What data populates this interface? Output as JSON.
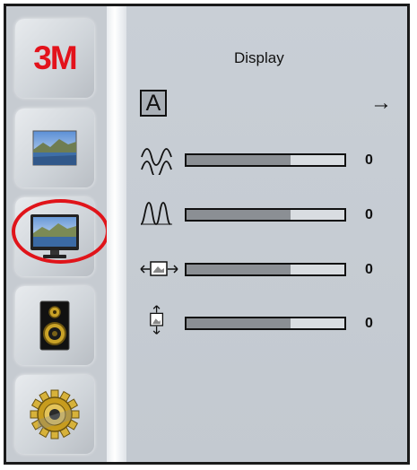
{
  "sidebar": {
    "logo_text": "3M",
    "items": [
      {
        "icon": "picture-icon"
      },
      {
        "icon": "monitor-icon",
        "selected": true
      },
      {
        "icon": "speaker-icon"
      },
      {
        "icon": "gear-icon"
      }
    ]
  },
  "panel": {
    "title": "Display",
    "auto_adjust_label": "A",
    "rows": [
      {
        "icon": "clock-icon",
        "value": "0",
        "level": 0.66
      },
      {
        "icon": "phase-icon",
        "value": "0",
        "level": 0.66
      },
      {
        "icon": "horizontal-position-icon",
        "value": "0",
        "level": 0.66
      },
      {
        "icon": "vertical-position-icon",
        "value": "0",
        "level": 0.66
      }
    ]
  },
  "colors": {
    "accent": "#e3121b",
    "fill": "#8b8f94"
  }
}
